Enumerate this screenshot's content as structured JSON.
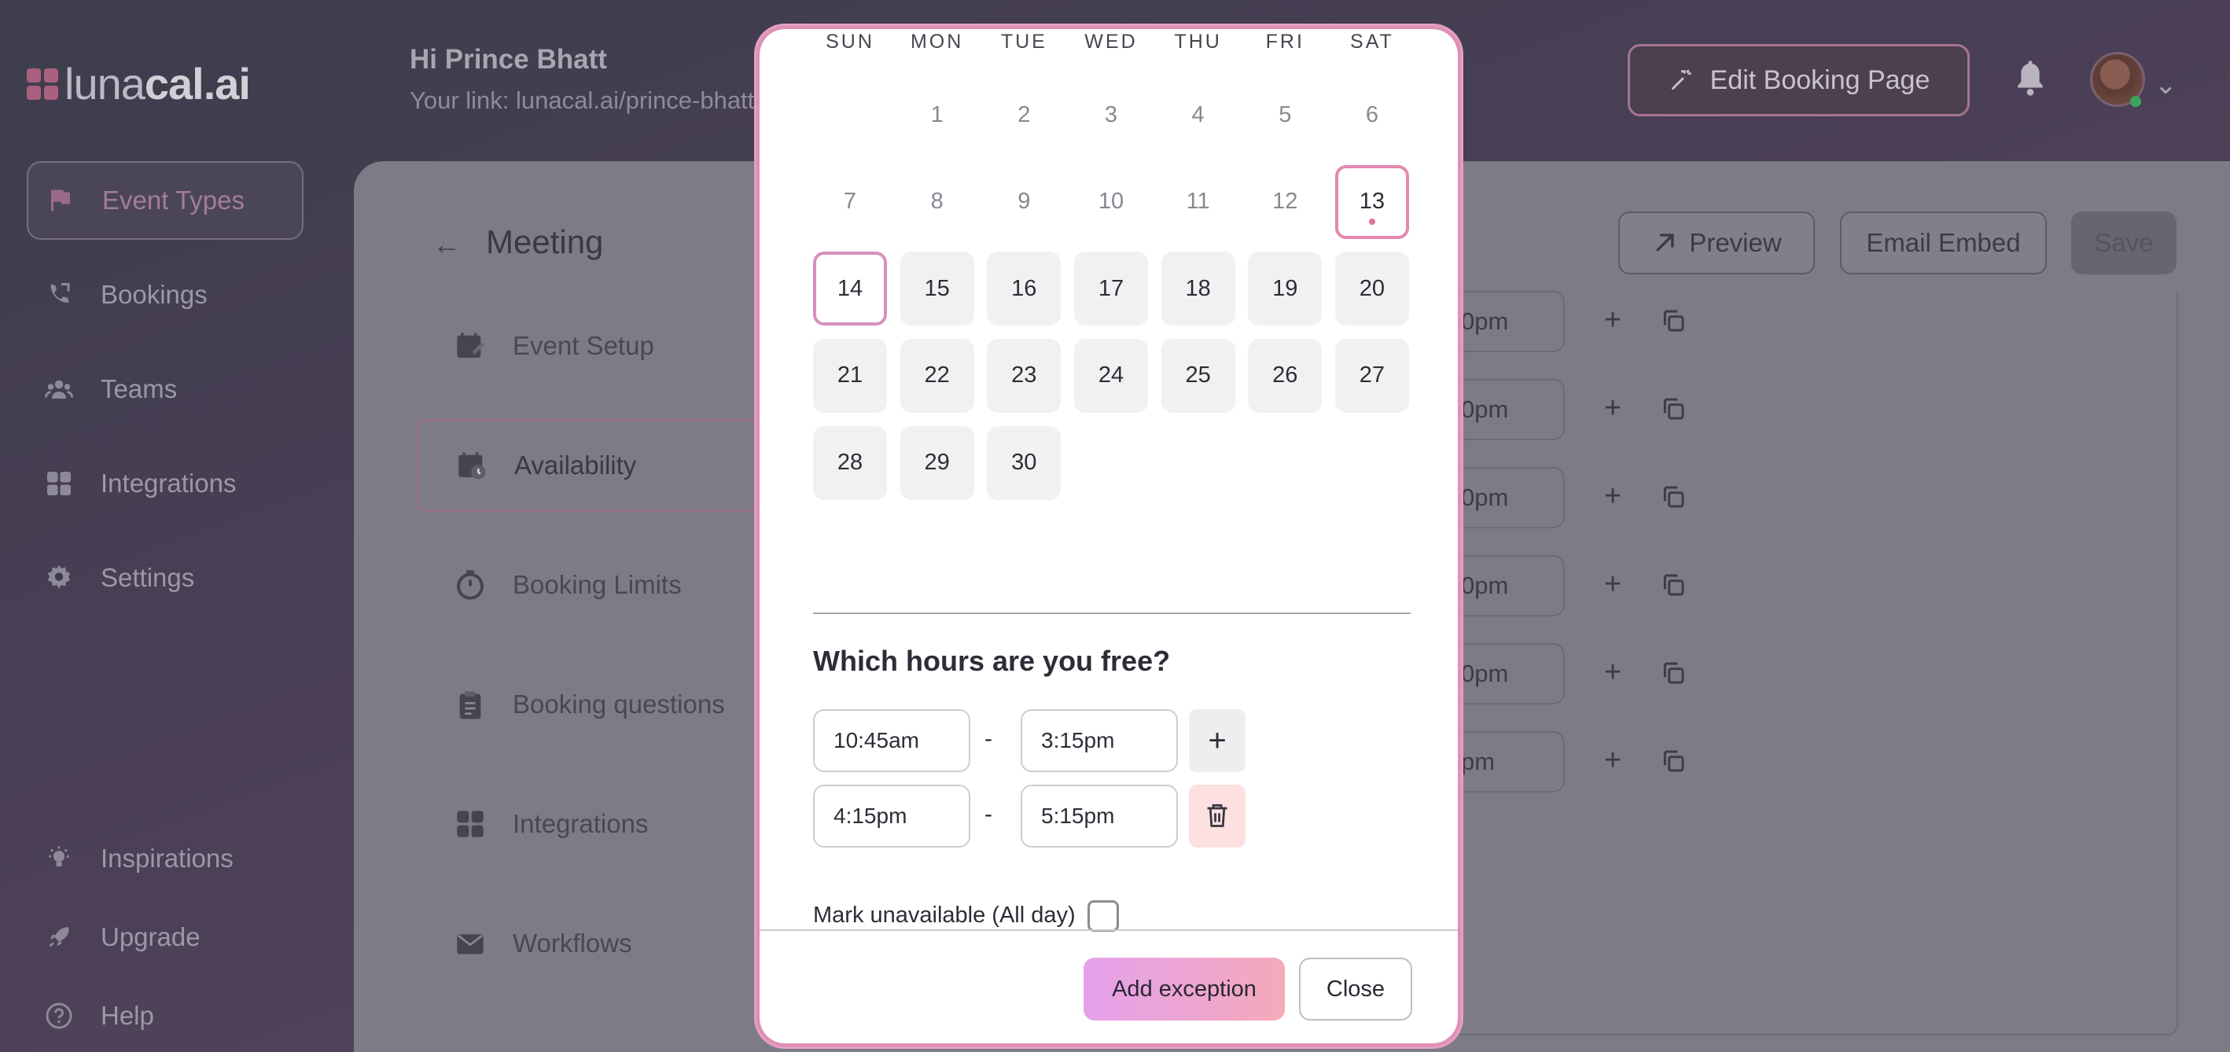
{
  "app": {
    "logo_light": "luna",
    "logo_bold": "cal.ai",
    "greeting": "Hi Prince Bhatt",
    "your_link": "Your link: lunacal.ai/prince-bhatt-",
    "edit_booking_label": "Edit Booking Page"
  },
  "sidebar": {
    "items": [
      {
        "label": "Event Types",
        "icon": "flag-icon"
      },
      {
        "label": "Bookings",
        "icon": "phone-icon"
      },
      {
        "label": "Teams",
        "icon": "users-icon"
      },
      {
        "label": "Integrations",
        "icon": "grid-icon"
      },
      {
        "label": "Settings",
        "icon": "gear-icon"
      },
      {
        "label": "Inspirations",
        "icon": "lightbulb-icon"
      },
      {
        "label": "Upgrade",
        "icon": "rocket-icon"
      },
      {
        "label": "Help",
        "icon": "help-icon"
      }
    ]
  },
  "event_page": {
    "title": "Meeting",
    "preview_label": "Preview",
    "email_embed_label": "Email Embed",
    "save_label": "Save",
    "menu": [
      {
        "label": "Event Setup",
        "icon": "calendar-edit-icon"
      },
      {
        "label": "Availability",
        "icon": "calendar-clock-icon"
      },
      {
        "label": "Booking Limits",
        "icon": "timer-icon"
      },
      {
        "label": "Booking questions",
        "icon": "clipboard-icon"
      },
      {
        "label": "Integrations",
        "icon": "grid-icon"
      },
      {
        "label": "Workflows",
        "icon": "mail-icon"
      }
    ],
    "time_rows": [
      "0pm",
      "0pm",
      "0pm",
      "0pm",
      "0pm",
      "pm"
    ]
  },
  "modal": {
    "weekdays": [
      "SUN",
      "MON",
      "TUE",
      "WED",
      "THU",
      "FRI",
      "SAT"
    ],
    "days": [
      {
        "label": "",
        "state": "empty"
      },
      {
        "label": "1",
        "state": "past"
      },
      {
        "label": "2",
        "state": "past"
      },
      {
        "label": "3",
        "state": "past"
      },
      {
        "label": "4",
        "state": "past"
      },
      {
        "label": "5",
        "state": "past"
      },
      {
        "label": "6",
        "state": "past"
      },
      {
        "label": "7",
        "state": "past"
      },
      {
        "label": "8",
        "state": "past"
      },
      {
        "label": "9",
        "state": "past"
      },
      {
        "label": "10",
        "state": "past"
      },
      {
        "label": "11",
        "state": "past"
      },
      {
        "label": "12",
        "state": "past"
      },
      {
        "label": "13",
        "state": "today"
      },
      {
        "label": "14",
        "state": "selected"
      },
      {
        "label": "15",
        "state": "avail"
      },
      {
        "label": "16",
        "state": "avail"
      },
      {
        "label": "17",
        "state": "avail"
      },
      {
        "label": "18",
        "state": "avail"
      },
      {
        "label": "19",
        "state": "avail"
      },
      {
        "label": "20",
        "state": "avail"
      },
      {
        "label": "21",
        "state": "avail"
      },
      {
        "label": "22",
        "state": "avail"
      },
      {
        "label": "23",
        "state": "avail"
      },
      {
        "label": "24",
        "state": "avail"
      },
      {
        "label": "25",
        "state": "avail"
      },
      {
        "label": "26",
        "state": "avail"
      },
      {
        "label": "27",
        "state": "avail"
      },
      {
        "label": "28",
        "state": "avail"
      },
      {
        "label": "29",
        "state": "avail"
      },
      {
        "label": "30",
        "state": "avail"
      }
    ],
    "hours_title": "Which hours are you free?",
    "slots": [
      {
        "start": "10:45am",
        "end": "3:15pm",
        "action": "add"
      },
      {
        "start": "4:15pm",
        "end": "5:15pm",
        "action": "delete"
      }
    ],
    "dash": "-",
    "mark_unavailable_label": "Mark unavailable (All day)",
    "mark_unavailable_checked": false,
    "add_exception_label": "Add exception",
    "close_label": "Close"
  },
  "colors": {
    "accent_pink": "#e489b0",
    "accent_gradient_start": "#e4a1eb",
    "accent_gradient_end": "#f4aab8",
    "delete_bg": "#fde0e0"
  }
}
